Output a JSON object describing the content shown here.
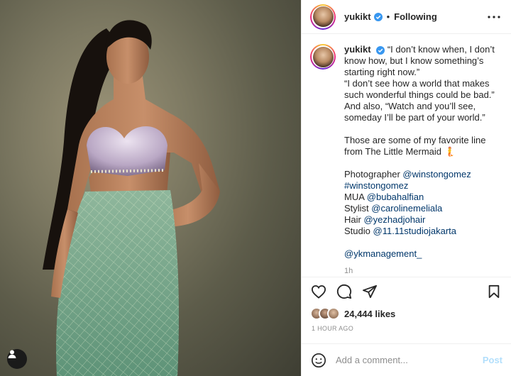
{
  "post": {
    "username": "yukikt",
    "separator": "•",
    "following_label": "Following"
  },
  "caption": {
    "username": "yukikt",
    "lines": [
      "“I don’t know when, I don’t know how, but I know something’s starting right now.”",
      "“I don’t see how a world that makes such wonderful things could be bad.”",
      "And also, “Watch and you’ll see, someday I’ll be part of your world.”",
      "",
      "Those are some of my favorite line from The Little Mermaid 🧜",
      ""
    ],
    "credits": {
      "photographer_label": "Photographer",
      "photographer": "@winstongomez",
      "hashtag": "#winstongomez",
      "mua_label": "MUA",
      "mua": "@bubahalfian",
      "stylist_label": "Stylist",
      "stylist": "@carolinemeliala",
      "hair_label": "Hair",
      "hair": "@yezhadjohair",
      "studio_label": "Studio",
      "studio": "@11.11studiojakarta",
      "management": "@ykmanagement_"
    },
    "time": "1h"
  },
  "likes": {
    "count_text": "24,444 likes"
  },
  "post_time": "1 HOUR AGO",
  "comment": {
    "placeholder": "Add a comment...",
    "post_label": "Post"
  },
  "icons": {
    "verified": "verified-badge-icon",
    "more": "more-options-icon",
    "heart": "heart-icon",
    "comment": "comment-icon",
    "share": "share-icon",
    "save": "bookmark-icon",
    "emoji": "emoji-icon",
    "user_tag": "user-tag-icon"
  },
  "colors": {
    "verified": "#3897f0",
    "mention": "#00376b",
    "post_button_disabled": "#b2dffc"
  }
}
